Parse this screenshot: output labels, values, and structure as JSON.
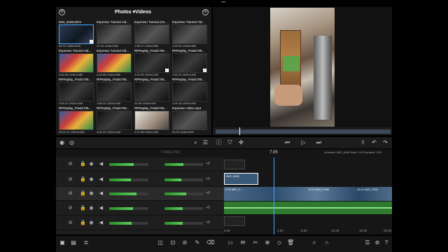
{
  "browser": {
    "title": "Photos ▾Videos",
    "items": [
      {
        "name": "IMG_6188.MOV",
        "meta": "50.04  1080x1920",
        "style": "img-a",
        "selected": true,
        "check": "✓"
      },
      {
        "name": "Espresso Tutorial Vid...",
        "meta": "47.18  1440x1080",
        "style": "img-b",
        "selected": false,
        "check": ""
      },
      {
        "name": "Espresso Tutorial (Ho...",
        "meta": "1:38.17  1440x1080",
        "style": "img-b",
        "selected": false,
        "check": ""
      },
      {
        "name": "Espresso Tutorial Vid...",
        "meta": "1:25.03  1440x1080",
        "style": "img-b",
        "selected": false,
        "check": ""
      },
      {
        "name": "Espresso Tutorial Vid...",
        "meta": "4:44.08  1440x1080",
        "style": "img-c",
        "selected": false,
        "check": ""
      },
      {
        "name": "Espresso Tutorial Vid...",
        "meta": "4:44.08  1440x1080",
        "style": "img-c",
        "selected": false,
        "check": ""
      },
      {
        "name": "RPReplay_Final1705...",
        "meta": "1:43.28  1920x1440",
        "style": "img-d",
        "selected": false,
        "check": "✓"
      },
      {
        "name": "RPReplay_Final1705...",
        "meta": "1:52.23  1920x1440",
        "style": "img-d",
        "selected": false,
        "check": "✓"
      },
      {
        "name": "RPReplay_Final1705...",
        "meta": "1:52.22  1920x1440",
        "style": "img-d",
        "selected": false,
        "check": ""
      },
      {
        "name": "RPReplay_Final1705...",
        "meta": "1:55.22  1920x1440",
        "style": "img-d",
        "selected": false,
        "check": ""
      },
      {
        "name": "RPReplay_Final1705...",
        "meta": "20.08  1920x1440",
        "style": "img-d",
        "selected": false,
        "check": ""
      },
      {
        "name": "RPReplay_Final1705...",
        "meta": "1:02.18  1920x1440",
        "style": "img-d",
        "selected": false,
        "check": ""
      },
      {
        "name": "RPReplay_Final1705...",
        "meta": "20:01.47  1920x1440",
        "style": "img-c",
        "selected": false,
        "check": ""
      },
      {
        "name": "RPReplay_Final1705...",
        "meta": "4:40.19  1920x1440",
        "style": "img-d",
        "selected": false,
        "check": ""
      },
      {
        "name": "RPReplay_Final1705...",
        "meta": "2:27.08  1920x1440",
        "style": "img-e",
        "selected": false,
        "check": ""
      },
      {
        "name": "Espresso Video.mp4",
        "meta": "51.09  1080x1920",
        "style": "img-b",
        "selected": false,
        "check": ""
      }
    ]
  },
  "timeline": {
    "label": "TIMELINE",
    "playhead_time": "7.05",
    "info": "Selected: IMG_6188  Start: 0.00  Duration: 5.00",
    "clip_small_label": "IMG_6188",
    "clip_labels": [
      "2.19  IMG_2...",
      "10.21  IMG_2788",
      "10.21  IMG_2759"
    ],
    "ruler": [
      "0.00",
      "4.00",
      "8.00",
      "12.00",
      "16.00",
      "20.00"
    ],
    "tracks": [
      {
        "db": "+0",
        "fill": 0.62
      },
      {
        "db": "+0",
        "fill": 0.55
      },
      {
        "db": "+0",
        "fill": 0.7
      },
      {
        "db": "+0",
        "fill": 0.6
      },
      {
        "db": "+0",
        "fill": 0.58
      }
    ]
  },
  "icons": {
    "settings": "⚙",
    "close": "⊖"
  }
}
